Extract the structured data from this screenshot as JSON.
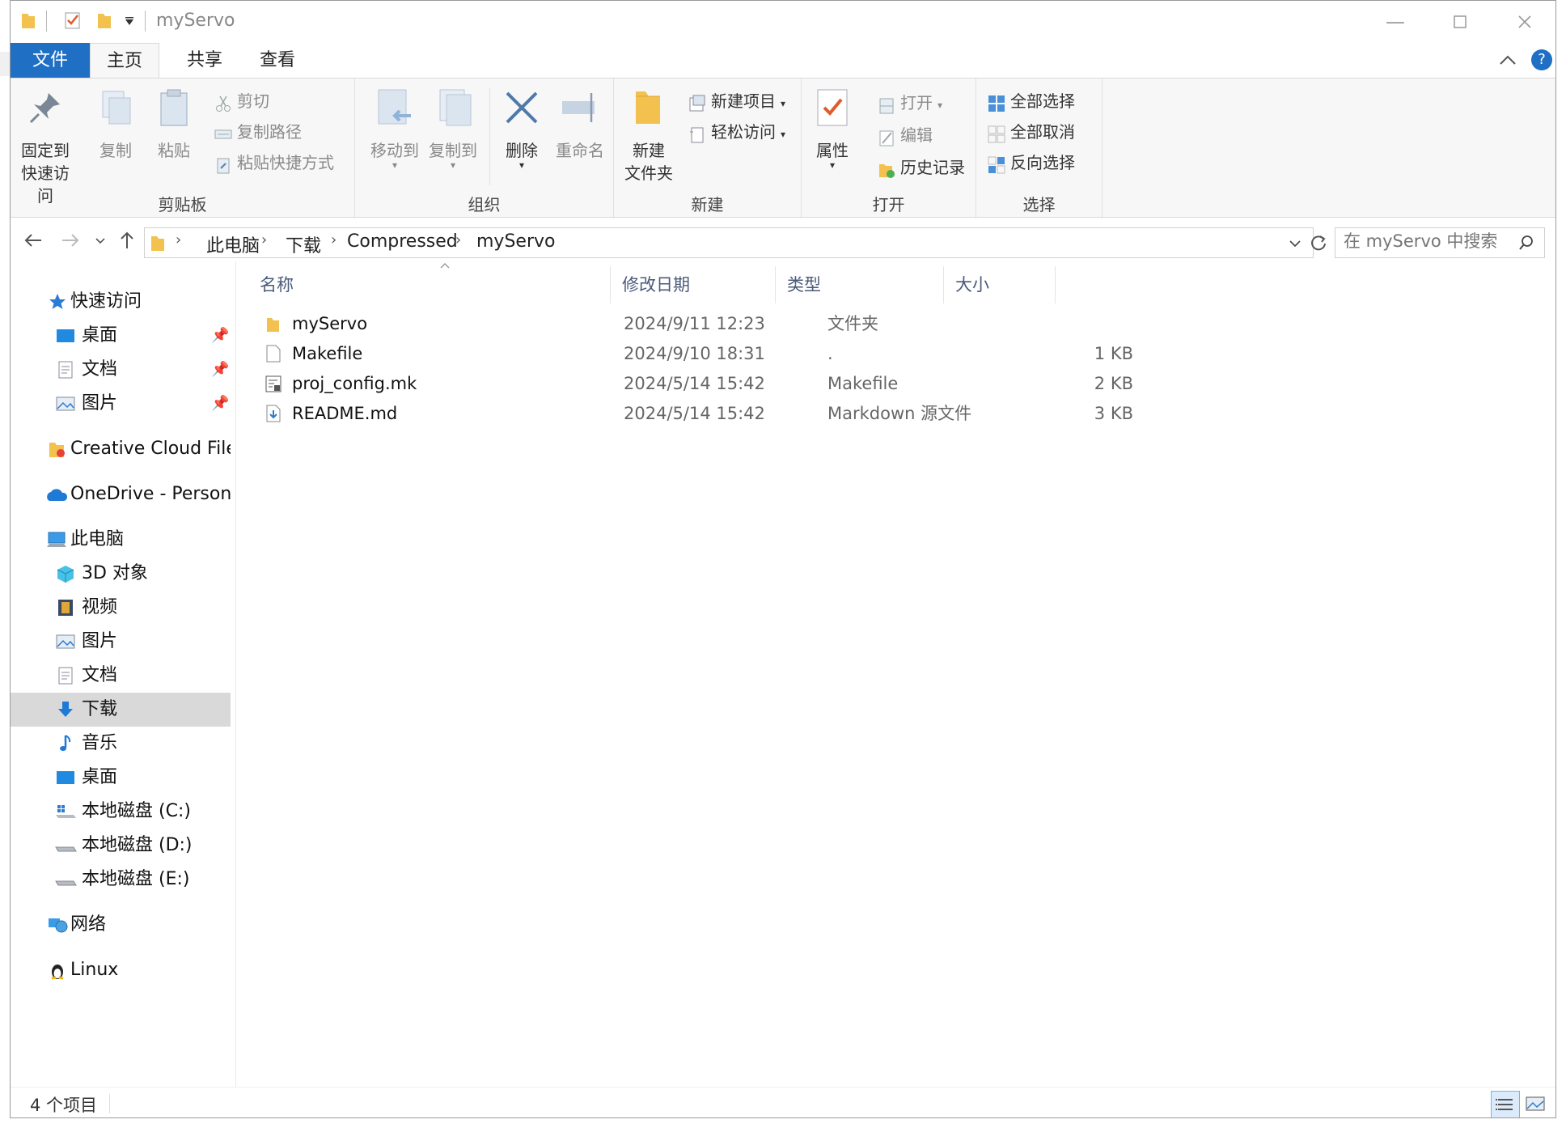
{
  "window": {
    "title": "myServo"
  },
  "tabs": [
    {
      "label": "文件"
    },
    {
      "label": "主页"
    },
    {
      "label": "共享"
    },
    {
      "label": "查看"
    }
  ],
  "ribbon": {
    "clipboard": {
      "group_label": "剪贴板",
      "pin_l1": "固定到",
      "pin_l2": "快速访问",
      "copy": "复制",
      "paste": "粘贴",
      "cut": "剪切",
      "copy_path": "复制路径",
      "paste_shortcut": "粘贴快捷方式"
    },
    "organize": {
      "group_label": "组织",
      "move_to": "移动到",
      "copy_to": "复制到",
      "delete": "删除",
      "rename": "重命名"
    },
    "new": {
      "group_label": "新建",
      "new_folder_l1": "新建",
      "new_folder_l2": "文件夹",
      "new_item": "新建项目",
      "easy_access": "轻松访问"
    },
    "open": {
      "group_label": "打开",
      "properties": "属性",
      "open": "打开",
      "edit": "编辑",
      "history": "历史记录"
    },
    "select": {
      "group_label": "选择",
      "select_all": "全部选择",
      "select_none": "全部取消",
      "invert": "反向选择"
    }
  },
  "address": {
    "crumbs": [
      "此电脑",
      "下载",
      "Compressed",
      "myServo"
    ],
    "search_placeholder": "在 myServo 中搜索"
  },
  "nav": {
    "quick_access": "快速访问",
    "qa_items": [
      {
        "label": "桌面"
      },
      {
        "label": "文档"
      },
      {
        "label": "图片"
      }
    ],
    "creative_cloud": "Creative Cloud Files",
    "onedrive": "OneDrive - Persona",
    "this_pc": "此电脑",
    "pc_items": [
      {
        "label": "3D 对象"
      },
      {
        "label": "视频"
      },
      {
        "label": "图片"
      },
      {
        "label": "文档"
      },
      {
        "label": "下载"
      },
      {
        "label": "音乐"
      },
      {
        "label": "桌面"
      },
      {
        "label": "本地磁盘 (C:)"
      },
      {
        "label": "本地磁盘 (D:)"
      },
      {
        "label": "本地磁盘 (E:)"
      }
    ],
    "network": "网络",
    "linux": "Linux"
  },
  "columns": {
    "name": "名称",
    "date": "修改日期",
    "type": "类型",
    "size": "大小"
  },
  "files": [
    {
      "name": "myServo",
      "date": "2024/9/11 12:23",
      "type": "文件夹",
      "size": ""
    },
    {
      "name": "Makefile",
      "date": "2024/9/10 18:31",
      "type": ".",
      "size": "1 KB"
    },
    {
      "name": "proj_config.mk",
      "date": "2024/5/14 15:42",
      "type": "Makefile",
      "size": "2 KB"
    },
    {
      "name": "README.md",
      "date": "2024/5/14 15:42",
      "type": "Markdown 源文件",
      "size": "3 KB"
    }
  ],
  "status": {
    "count": "4 个项目"
  },
  "colors": {
    "accent": "#1f6fc5",
    "folder": "#f2c14e",
    "selected": "#d9d9d9"
  }
}
